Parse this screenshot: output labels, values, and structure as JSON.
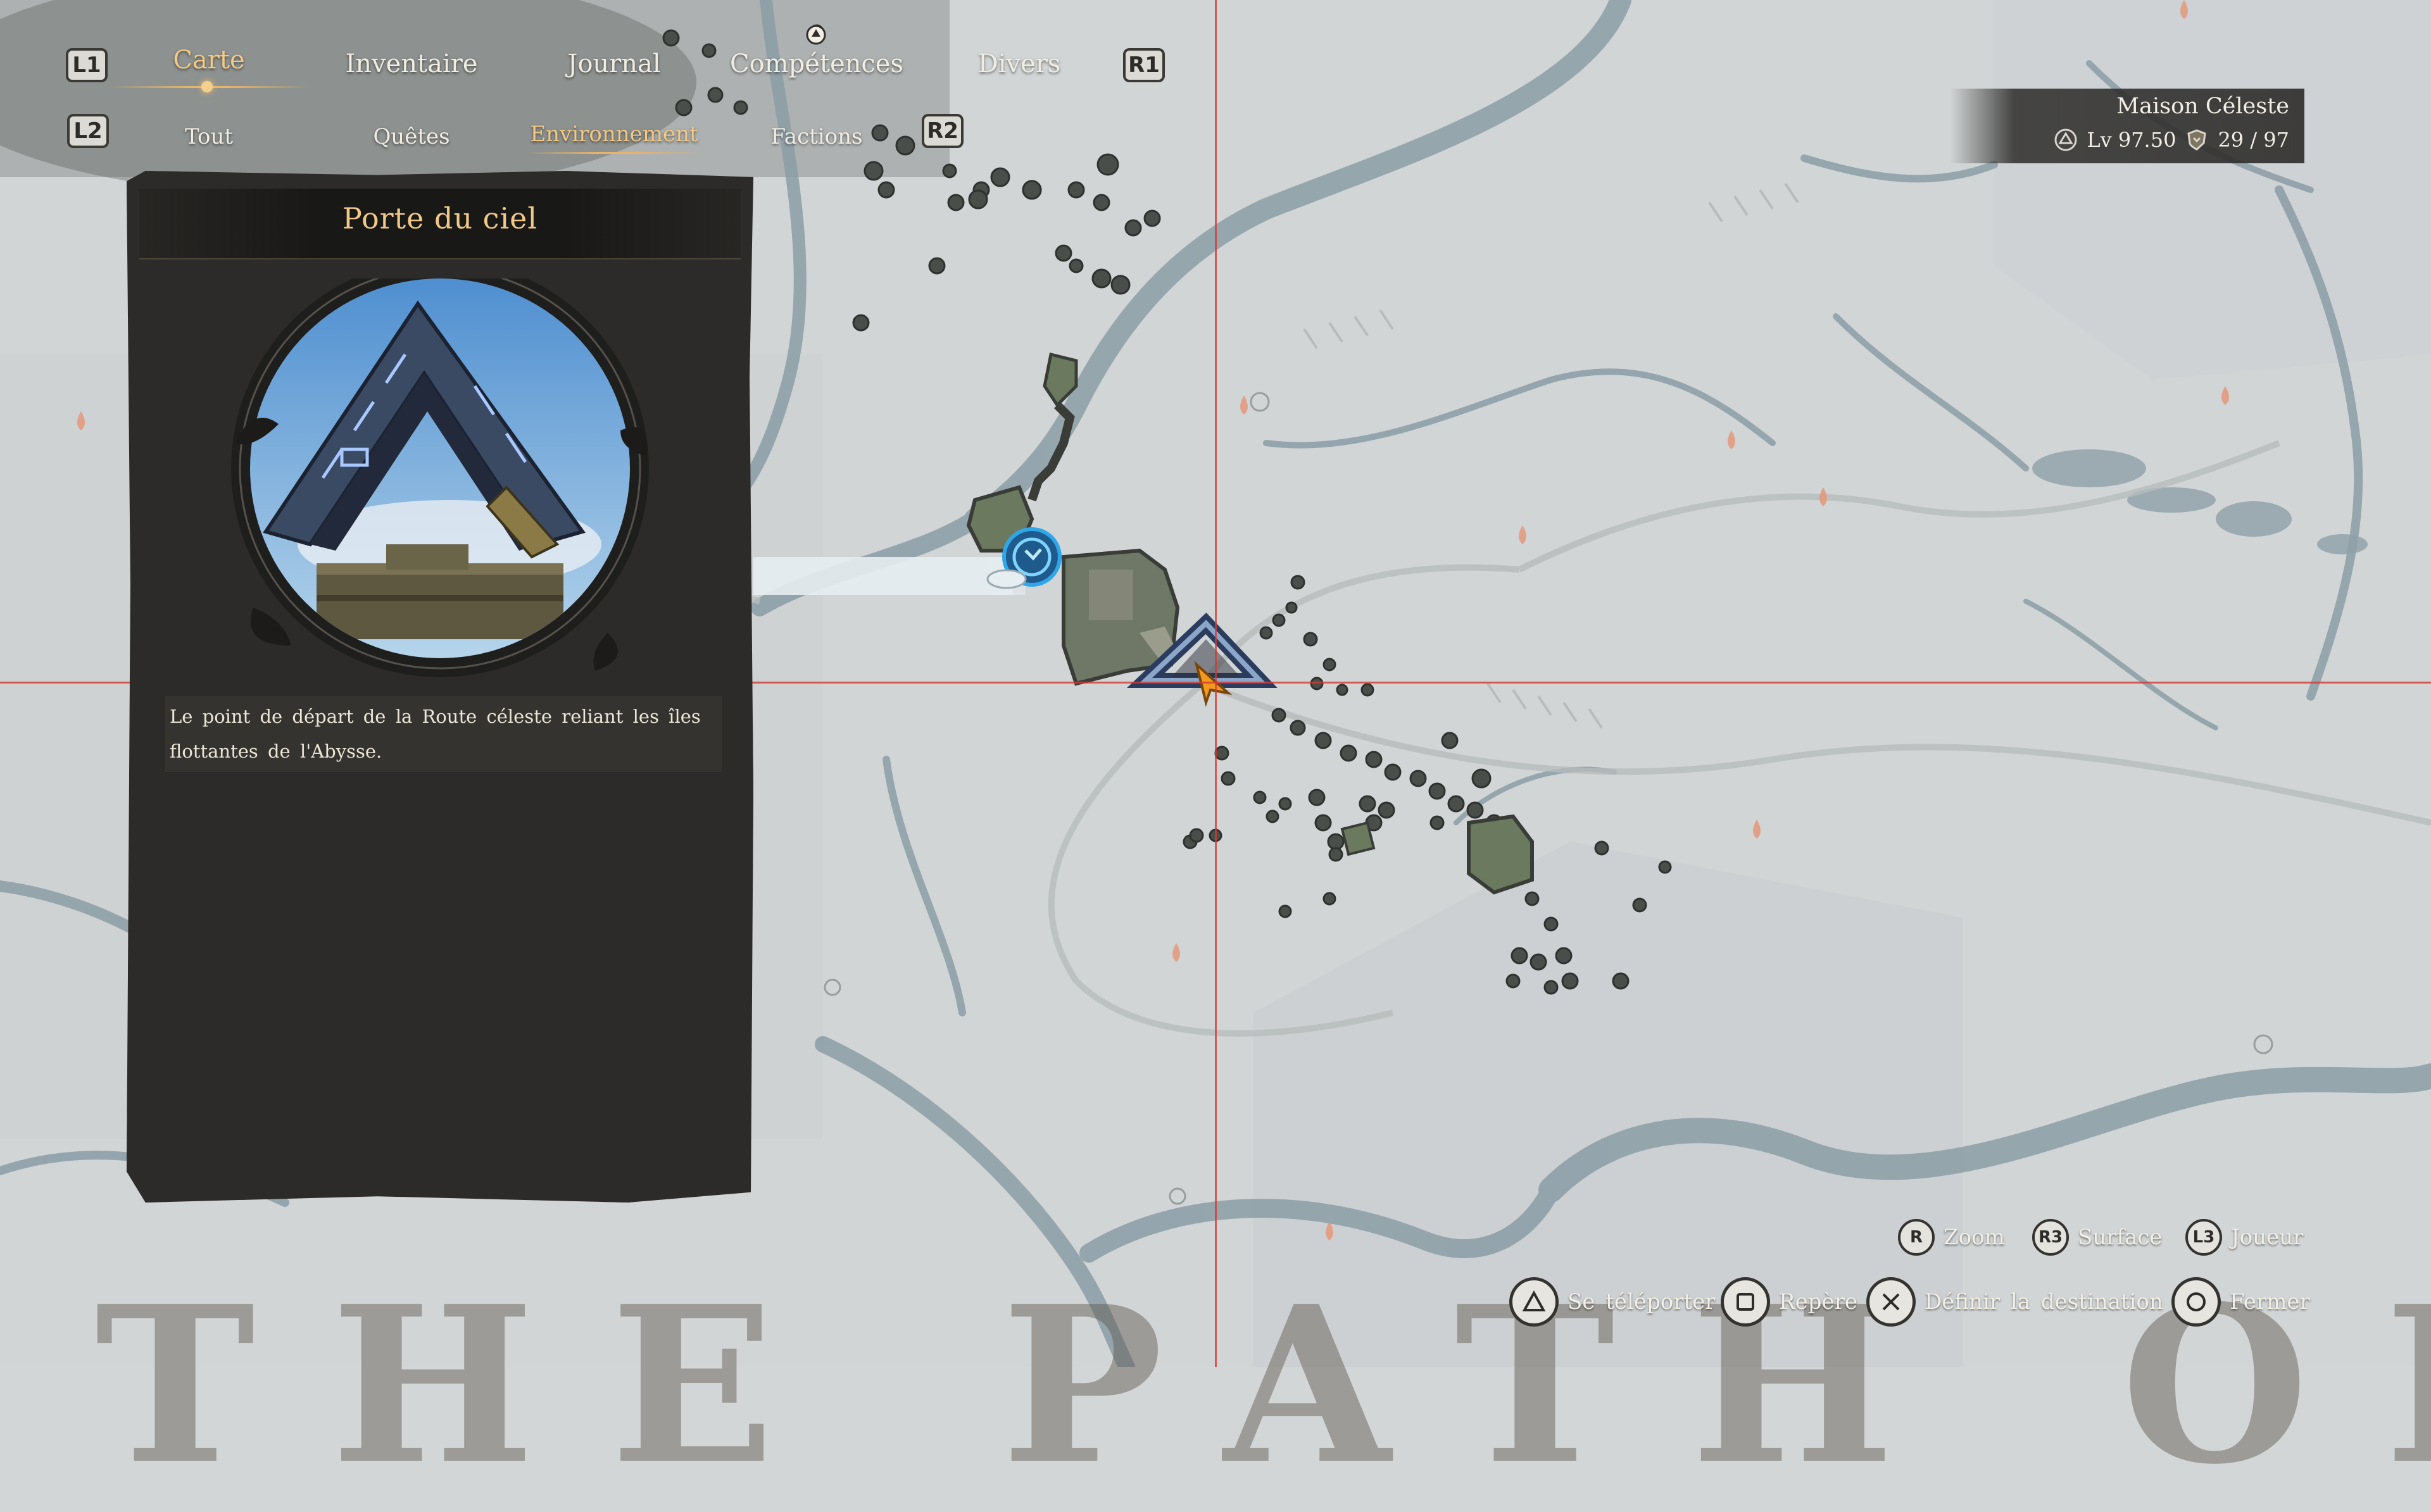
{
  "nav": {
    "left_bumper": "L1",
    "right_bumper": "R1",
    "left_trigger": "L2",
    "right_trigger": "R2",
    "tabs": [
      {
        "label": "Carte",
        "active": true
      },
      {
        "label": "Inventaire",
        "active": false
      },
      {
        "label": "Journal",
        "active": false
      },
      {
        "label": "Compétences",
        "active": false
      },
      {
        "label": "Divers",
        "active": false
      }
    ],
    "subtabs": [
      {
        "label": "Tout",
        "active": false
      },
      {
        "label": "Quêtes",
        "active": false
      },
      {
        "label": "Environnement",
        "active": true
      },
      {
        "label": "Factions",
        "active": false
      }
    ]
  },
  "location": {
    "name": "Maison Céleste",
    "level": "Lv  97.50",
    "count": "29  /  97"
  },
  "info_panel": {
    "title": "Porte du ciel",
    "description": "Le point de départ de la Route céleste reliant les îles flottantes de l'Abysse."
  },
  "prompts": {
    "zoom": {
      "button": "R",
      "label": "Zoom"
    },
    "surface": {
      "button": "R3",
      "label": "Surface"
    },
    "player": {
      "button": "L3",
      "label": "Joueur"
    },
    "teleport": {
      "button": "triangle",
      "label": "Se téléporter"
    },
    "marker": {
      "button": "square",
      "label": "Repère"
    },
    "destination": {
      "button": "cross",
      "label": "Définir la destination"
    },
    "close": {
      "button": "circle",
      "label": "Fermer"
    }
  },
  "watermark": "THE PATH OF",
  "colors": {
    "accent": "#f3c983",
    "crosshair": "#d6383280",
    "map_background": "#d3d6d7",
    "river": "#8b9da6",
    "panel": "#2c2b29"
  },
  "icons": [
    "sky-gate-icon",
    "teleport-waypoint-icon",
    "player-arrow-icon",
    "campfire-icon",
    "level-icon",
    "shield-icon"
  ]
}
